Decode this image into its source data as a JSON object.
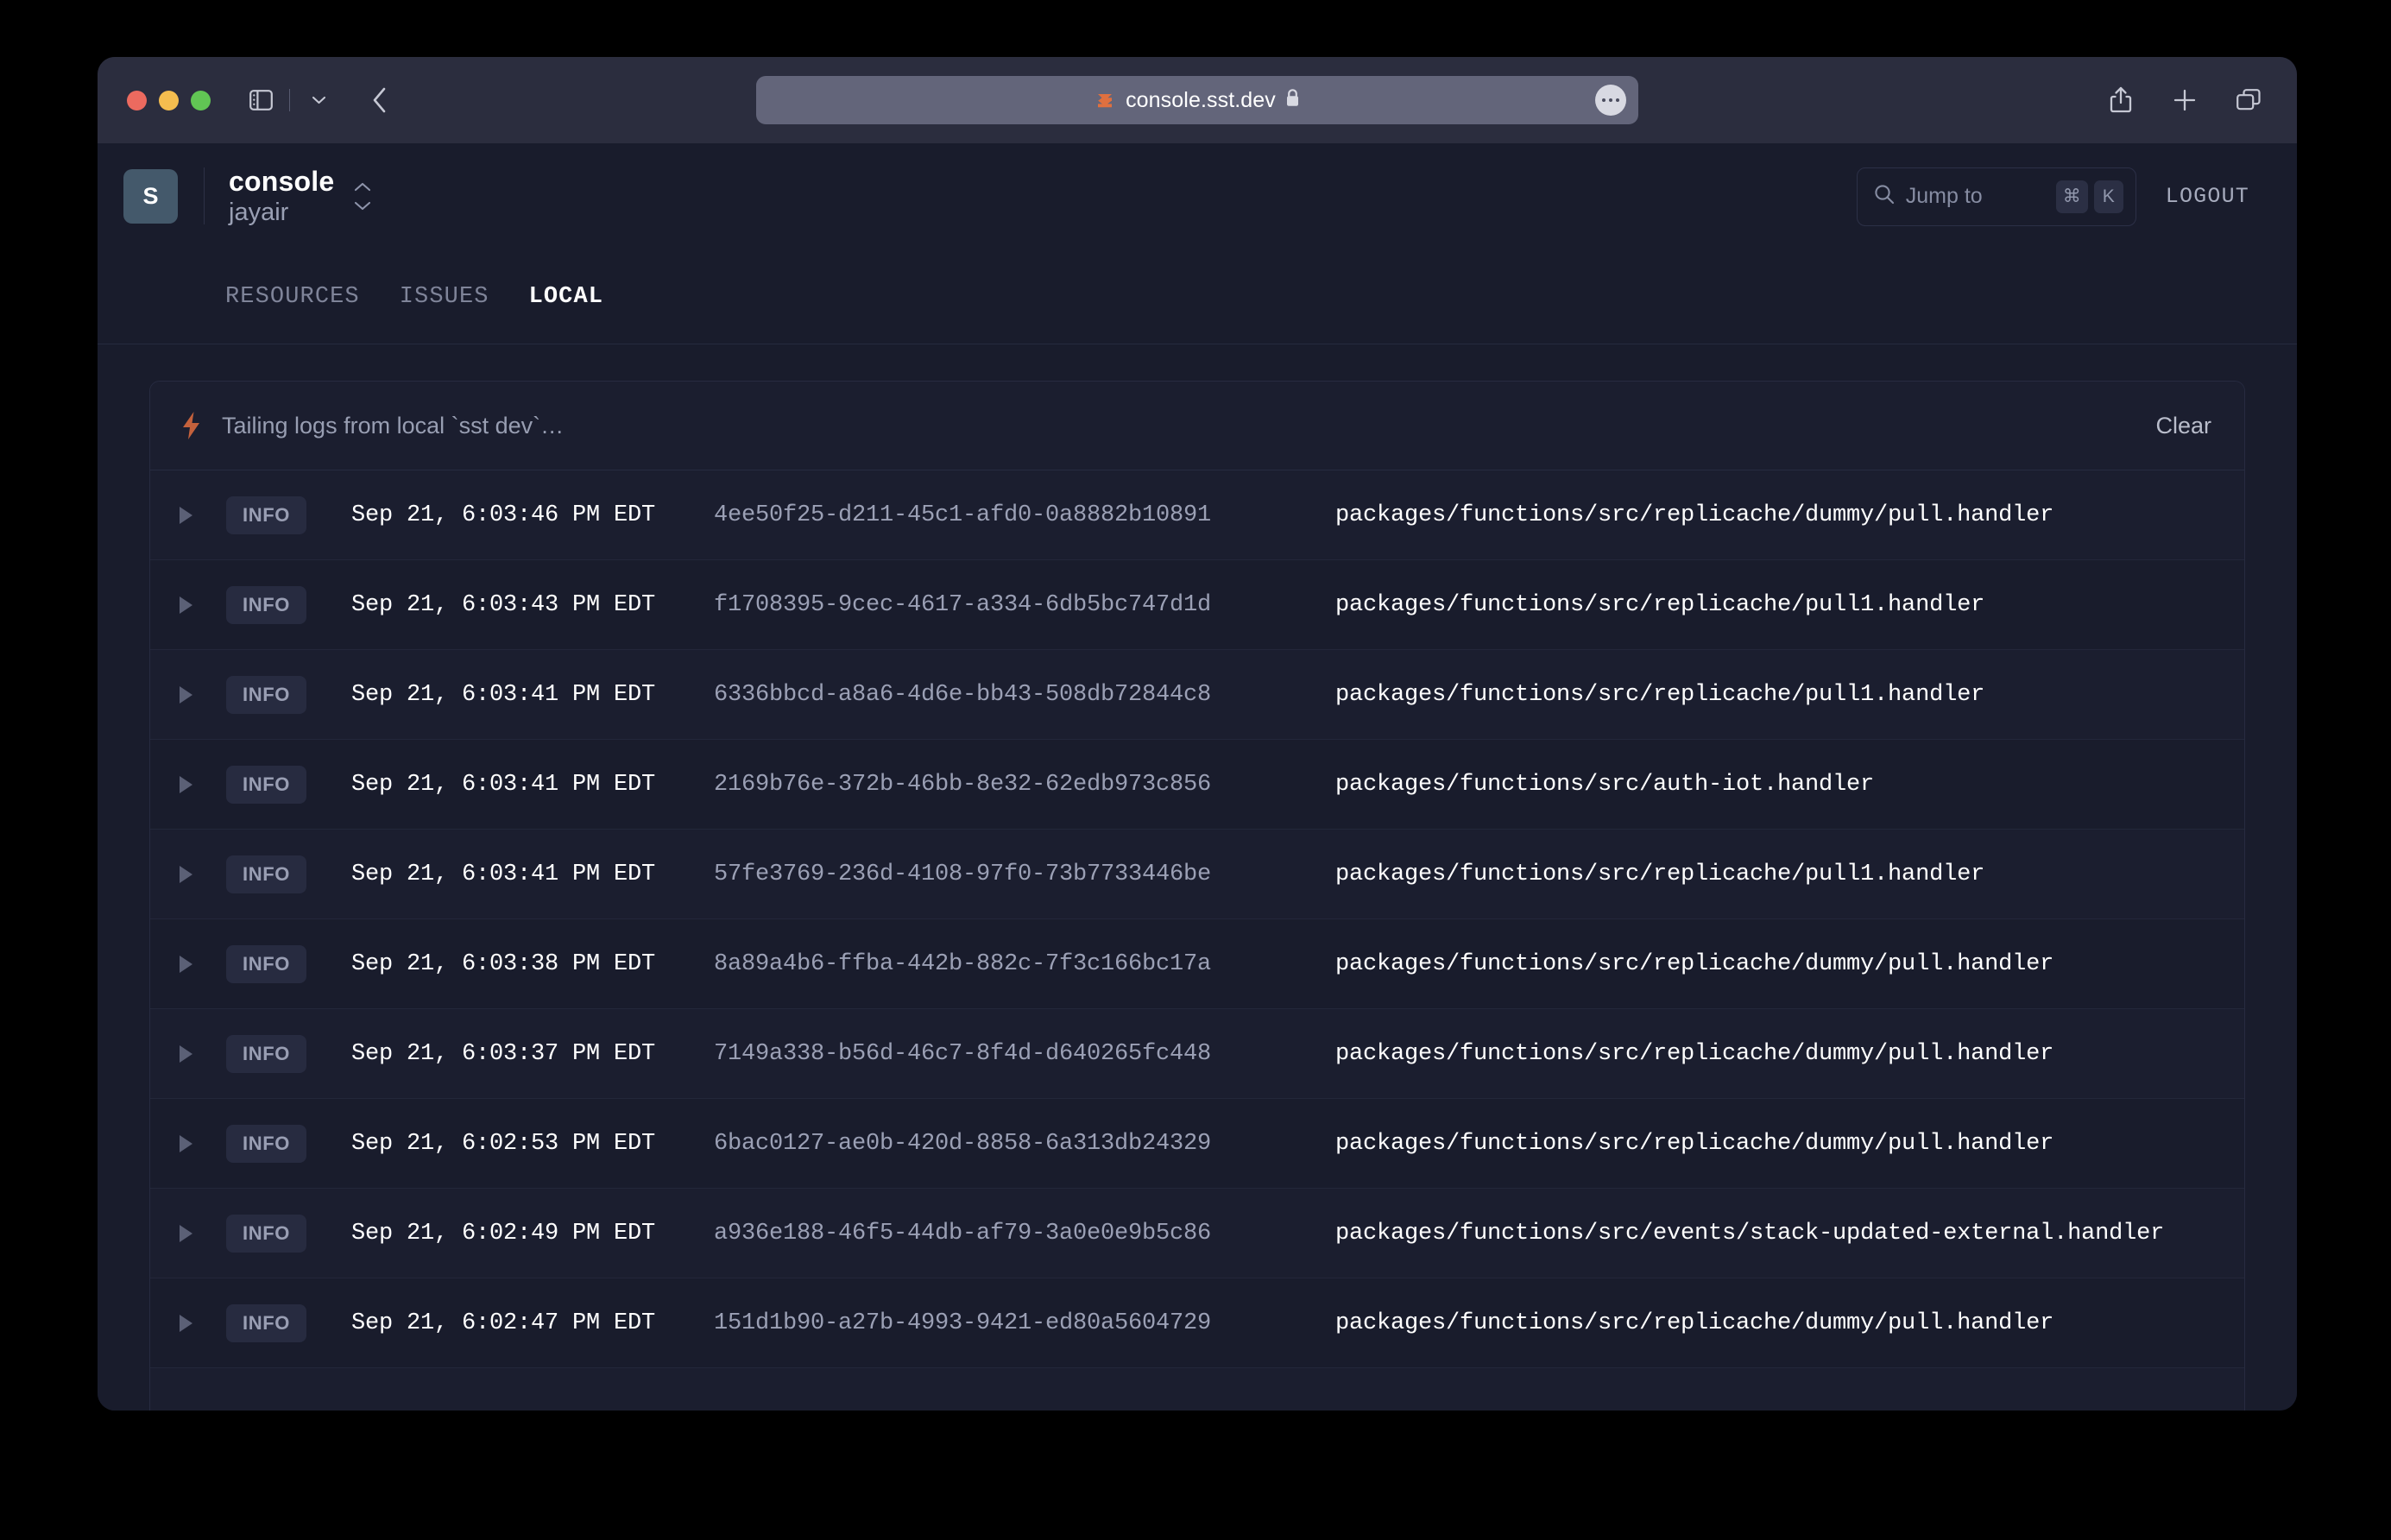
{
  "browser": {
    "url": "console.sst.dev",
    "icons": {
      "sidebar": "sidebar-icon",
      "sidebar_chevron": "chevron-down-icon",
      "back": "back-chevron-icon",
      "favicon": "sst-favicon-icon",
      "lock": "lock-icon",
      "more": "more-options-icon",
      "share": "share-icon",
      "new_tab": "plus-icon",
      "tab_overview": "tab-overview-icon"
    },
    "traffic_lights": {
      "close": "#ec6a5f",
      "minimize": "#f4bd4f",
      "zoom": "#61c554"
    }
  },
  "header": {
    "avatar_initial": "S",
    "app_name": "console",
    "user_name": "jayair",
    "switcher_icon": "chevron-up-down-icon",
    "search": {
      "icon": "search-icon",
      "placeholder": "Jump to",
      "shortcut_keys": [
        "⌘",
        "K"
      ]
    },
    "logout_label": "LOGOUT"
  },
  "tabs": [
    {
      "label": "RESOURCES",
      "active": false
    },
    {
      "label": "ISSUES",
      "active": false
    },
    {
      "label": "LOCAL",
      "active": true
    }
  ],
  "panel": {
    "status_icon": "lightning-bolt-icon",
    "status_text": "Tailing logs from local `sst dev`…",
    "clear_label": "Clear",
    "accent_color": "#c4613c"
  },
  "logs": {
    "columns": [
      "disclosure",
      "level",
      "timestamp",
      "request_id",
      "handler"
    ],
    "rows": [
      {
        "level": "INFO",
        "timestamp": "Sep 21, 6:03:46 PM EDT",
        "request_id": "4ee50f25-d211-45c1-afd0-0a8882b10891",
        "handler": "packages/functions/src/replicache/dummy/pull.handler"
      },
      {
        "level": "INFO",
        "timestamp": "Sep 21, 6:03:43 PM EDT",
        "request_id": "f1708395-9cec-4617-a334-6db5bc747d1d",
        "handler": "packages/functions/src/replicache/pull1.handler"
      },
      {
        "level": "INFO",
        "timestamp": "Sep 21, 6:03:41 PM EDT",
        "request_id": "6336bbcd-a8a6-4d6e-bb43-508db72844c8",
        "handler": "packages/functions/src/replicache/pull1.handler"
      },
      {
        "level": "INFO",
        "timestamp": "Sep 21, 6:03:41 PM EDT",
        "request_id": "2169b76e-372b-46bb-8e32-62edb973c856",
        "handler": "packages/functions/src/auth-iot.handler"
      },
      {
        "level": "INFO",
        "timestamp": "Sep 21, 6:03:41 PM EDT",
        "request_id": "57fe3769-236d-4108-97f0-73b7733446be",
        "handler": "packages/functions/src/replicache/pull1.handler"
      },
      {
        "level": "INFO",
        "timestamp": "Sep 21, 6:03:38 PM EDT",
        "request_id": "8a89a4b6-ffba-442b-882c-7f3c166bc17a",
        "handler": "packages/functions/src/replicache/dummy/pull.handler"
      },
      {
        "level": "INFO",
        "timestamp": "Sep 21, 6:03:37 PM EDT",
        "request_id": "7149a338-b56d-46c7-8f4d-d640265fc448",
        "handler": "packages/functions/src/replicache/dummy/pull.handler"
      },
      {
        "level": "INFO",
        "timestamp": "Sep 21, 6:02:53 PM EDT",
        "request_id": "6bac0127-ae0b-420d-8858-6a313db24329",
        "handler": "packages/functions/src/replicache/dummy/pull.handler"
      },
      {
        "level": "INFO",
        "timestamp": "Sep 21, 6:02:49 PM EDT",
        "request_id": "a936e188-46f5-44db-af79-3a0e0e9b5c86",
        "handler": "packages/functions/src/events/stack-updated-external.handler"
      },
      {
        "level": "INFO",
        "timestamp": "Sep 21, 6:02:47 PM EDT",
        "request_id": "151d1b90-a27b-4993-9421-ed80a5604729",
        "handler": "packages/functions/src/replicache/dummy/pull.handler"
      }
    ]
  }
}
